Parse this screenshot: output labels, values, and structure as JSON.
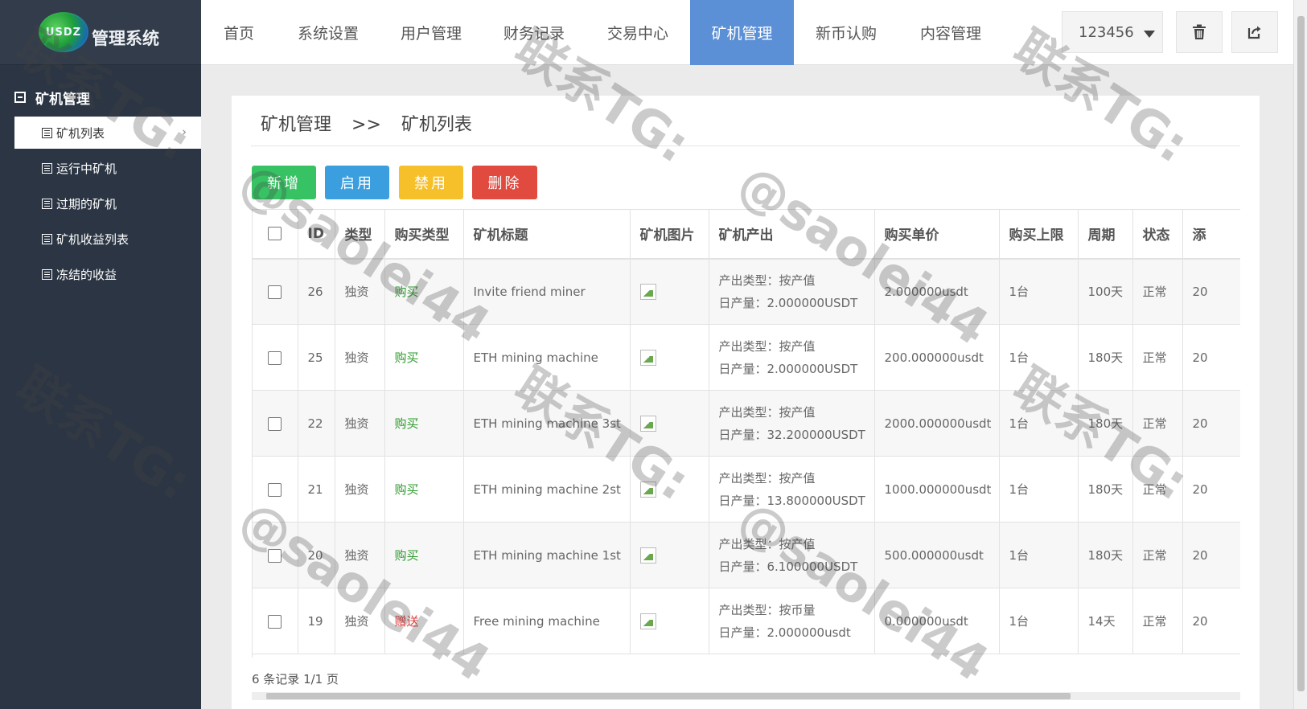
{
  "app": {
    "logo_text": "USDZ",
    "title": "管理系统"
  },
  "sidebar": {
    "group_label": "矿机管理",
    "items": [
      {
        "label": "矿机列表",
        "active": true
      },
      {
        "label": "运行中矿机"
      },
      {
        "label": "过期的矿机"
      },
      {
        "label": "矿机收益列表"
      },
      {
        "label": "冻结的收益"
      }
    ]
  },
  "topnav": {
    "items": [
      {
        "label": "首页"
      },
      {
        "label": "系统设置"
      },
      {
        "label": "用户管理"
      },
      {
        "label": "财务记录"
      },
      {
        "label": "交易中心"
      },
      {
        "label": "矿机管理",
        "active": true
      },
      {
        "label": "新币认购"
      },
      {
        "label": "内容管理"
      }
    ],
    "user": "123456",
    "icons": [
      "trash-icon",
      "logout-icon"
    ]
  },
  "breadcrumb": {
    "parent": "矿机管理",
    "separator": ">>",
    "current": "矿机列表"
  },
  "toolbar": {
    "add": "新增",
    "enable": "启用",
    "disable": "禁用",
    "delete": "删除"
  },
  "table": {
    "headers": [
      "ID",
      "类型",
      "购买类型",
      "矿机标题",
      "矿机图片",
      "矿机产出",
      "购买单价",
      "购买上限",
      "周期",
      "状态",
      "添"
    ],
    "rows": [
      {
        "id": "26",
        "type": "独资",
        "buy_type": "购买",
        "buy_color": "green",
        "title": "Invite friend miner",
        "out_type": "产出类型：按产值",
        "out_daily": "日产量：2.000000USDT",
        "price": "2.000000usdt",
        "limit": "1台",
        "cycle": "100天",
        "status": "正常",
        "added": "20"
      },
      {
        "id": "25",
        "type": "独资",
        "buy_type": "购买",
        "buy_color": "green",
        "title": "ETH mining machine",
        "out_type": "产出类型：按产值",
        "out_daily": "日产量：2.000000USDT",
        "price": "200.000000usdt",
        "limit": "1台",
        "cycle": "180天",
        "status": "正常",
        "added": "20"
      },
      {
        "id": "22",
        "type": "独资",
        "buy_type": "购买",
        "buy_color": "green",
        "title": "ETH mining machine 3st",
        "out_type": "产出类型：按产值",
        "out_daily": "日产量：32.200000USDT",
        "price": "2000.000000usdt",
        "limit": "1台",
        "cycle": "180天",
        "status": "正常",
        "added": "20"
      },
      {
        "id": "21",
        "type": "独资",
        "buy_type": "购买",
        "buy_color": "green",
        "title": "ETH mining machine 2st",
        "out_type": "产出类型：按产值",
        "out_daily": "日产量：13.800000USDT",
        "price": "1000.000000usdt",
        "limit": "1台",
        "cycle": "180天",
        "status": "正常",
        "added": "20"
      },
      {
        "id": "20",
        "type": "独资",
        "buy_type": "购买",
        "buy_color": "green",
        "title": "ETH mining machine 1st",
        "out_type": "产出类型：按产值",
        "out_daily": "日产量：6.100000USDT",
        "price": "500.000000usdt",
        "limit": "1台",
        "cycle": "180天",
        "status": "正常",
        "added": "20"
      },
      {
        "id": "19",
        "type": "独资",
        "buy_type": "赠送",
        "buy_color": "red",
        "title": "Free mining machine",
        "out_type": "产出类型：按币量",
        "out_daily": "日产量：2.000000usdt",
        "price": "0.000000usdt",
        "limit": "1台",
        "cycle": "14天",
        "status": "正常",
        "added": "20"
      }
    ]
  },
  "footer": {
    "records": "6 条记录 1/1 页"
  },
  "watermarks": [
    "联系TG:",
    "@saolei44"
  ]
}
